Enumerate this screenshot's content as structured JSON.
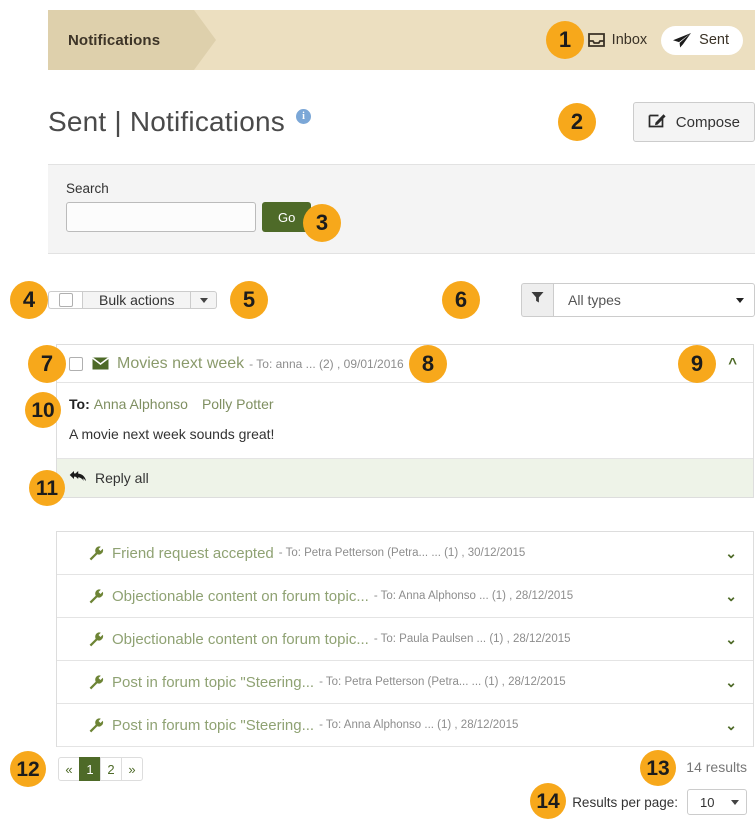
{
  "topbar": {
    "tab_label": "Notifications",
    "inbox_label": "Inbox",
    "sent_label": "Sent"
  },
  "header": {
    "title": "Sent | Notifications",
    "info_glyph": "i",
    "compose_label": "Compose"
  },
  "search": {
    "label": "Search",
    "value": "",
    "placeholder": "",
    "go_label": "Go"
  },
  "controls": {
    "bulk_actions_label": "Bulk actions",
    "filter_value": "All types"
  },
  "expanded_message": {
    "subject": "Movies next week",
    "meta": "- To: anna ... (2) , 09/01/2016",
    "to_label": "To:",
    "recipients": [
      "Anna Alphonso",
      "Polly Potter"
    ],
    "body": "A movie next week sounds great!",
    "reply_all_label": "Reply all"
  },
  "messages": [
    {
      "subject": "Friend request accepted",
      "meta": "- To: Petra Petterson (Petra... ... (1) , 30/12/2015"
    },
    {
      "subject": "Objectionable content on forum topic...",
      "meta": "- To: Anna Alphonso ... (1) , 28/12/2015"
    },
    {
      "subject": "Objectionable content on forum topic...",
      "meta": "- To: Paula Paulsen ... (1) , 28/12/2015"
    },
    {
      "subject": "Post in forum topic \"Steering...",
      "meta": "- To: Petra Petterson (Petra... ... (1) , 28/12/2015"
    },
    {
      "subject": "Post in forum topic \"Steering...",
      "meta": "- To: Anna Alphonso ... (1) , 28/12/2015"
    }
  ],
  "footer": {
    "pager": [
      "«",
      "1",
      "2",
      "»"
    ],
    "pager_current_index": 1,
    "results_count": "14 results",
    "results_per_page_label": "Results per page:",
    "results_per_page_value": "10"
  },
  "annotations": {
    "n1": "1",
    "n2": "2",
    "n3": "3",
    "n4": "4",
    "n5": "5",
    "n6": "6",
    "n7": "7",
    "n8": "8",
    "n9": "9",
    "n10": "10",
    "n11": "11",
    "n12": "12",
    "n13": "13",
    "n14": "14"
  },
  "colors": {
    "topbar_bg": "#ecdfc0",
    "tab_bg": "#ded0ac",
    "accent_green": "#4e6a28",
    "annotation_orange": "#f7a81b",
    "subject_green": "#8fa273"
  }
}
